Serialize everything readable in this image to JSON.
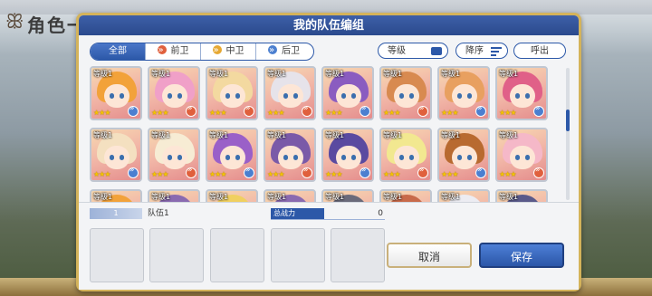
{
  "background": {
    "screen_title": "角色一览"
  },
  "dialog": {
    "title": "我的队伍编组"
  },
  "filters": {
    "tabs": [
      {
        "label": "全部",
        "active": true,
        "icon": null
      },
      {
        "label": "前卫",
        "active": false,
        "icon": "front-position-icon"
      },
      {
        "label": "中卫",
        "active": false,
        "icon": "middle-position-icon"
      },
      {
        "label": "后卫",
        "active": false,
        "icon": "back-position-icon"
      }
    ],
    "level_label": "等级",
    "sort_label": "降序",
    "call_label": "呼出"
  },
  "colors": {
    "accent_blue": "#2c58a8",
    "border_gold": "#d4b35a",
    "front": "#e0603d",
    "middle": "#e6a833",
    "back": "#4b7fd0",
    "star": "#f5c400"
  },
  "characters": [
    {
      "level": "等级1",
      "stars": "★★★",
      "position": "back",
      "hair": "#f2a23a"
    },
    {
      "level": "等级1",
      "stars": "★★★",
      "position": "front",
      "hair": "#f0a0c8"
    },
    {
      "level": "等级1",
      "stars": "★★★",
      "position": "front",
      "hair": "#f3d9a0"
    },
    {
      "level": "等级1",
      "stars": "★★★",
      "position": "front",
      "hair": "#e6e3ea"
    },
    {
      "level": "等级1",
      "stars": "★★★",
      "position": "back",
      "hair": "#8a5cc0"
    },
    {
      "level": "等级1",
      "stars": "★★★",
      "position": "front",
      "hair": "#d88a50"
    },
    {
      "level": "等级1",
      "stars": "★★★",
      "position": "back",
      "hair": "#e8a060"
    },
    {
      "level": "等级1",
      "stars": "★★★",
      "position": "back",
      "hair": "#e06088"
    },
    {
      "level": "等级1",
      "stars": "★★★",
      "position": "back",
      "hair": "#f4e0c0"
    },
    {
      "level": "等级1",
      "stars": "★★★",
      "position": "front",
      "hair": "#f7ecd4"
    },
    {
      "level": "等级1",
      "stars": "★★★",
      "position": "back",
      "hair": "#9a60c8"
    },
    {
      "level": "等级1",
      "stars": "★★★",
      "position": "front",
      "hair": "#7a5aa8"
    },
    {
      "level": "等级1",
      "stars": "★★★",
      "position": "back",
      "hair": "#5a4aa0"
    },
    {
      "level": "等级1",
      "stars": "★★★",
      "position": "front",
      "hair": "#f2e890"
    },
    {
      "level": "等级1",
      "stars": "★★★",
      "position": "back",
      "hair": "#b86a30"
    },
    {
      "level": "等级1",
      "stars": "★★★",
      "position": "front",
      "hair": "#f5b8c8"
    },
    {
      "level": "等级1",
      "stars": "",
      "position": "back",
      "hair": "#f2a23a"
    },
    {
      "level": "等级1",
      "stars": "",
      "position": "back",
      "hair": "#8a6ab0"
    },
    {
      "level": "等级1",
      "stars": "",
      "position": "back",
      "hair": "#f0d060"
    },
    {
      "level": "等级1",
      "stars": "",
      "position": "back",
      "hair": "#8a6ab0"
    },
    {
      "level": "等级1",
      "stars": "",
      "position": "back",
      "hair": "#6a6a7a"
    },
    {
      "level": "等级1",
      "stars": "",
      "position": "back",
      "hair": "#c86a4a"
    },
    {
      "level": "等级1",
      "stars": "",
      "position": "back",
      "hair": "#ececf2"
    },
    {
      "level": "等级1",
      "stars": "",
      "position": "back",
      "hair": "#5a5a8a"
    }
  ],
  "team": {
    "tag": "1",
    "name": "队伍1",
    "power_label": "总战力",
    "power_value": "0",
    "cancel_label": "取消",
    "save_label": "保存"
  }
}
